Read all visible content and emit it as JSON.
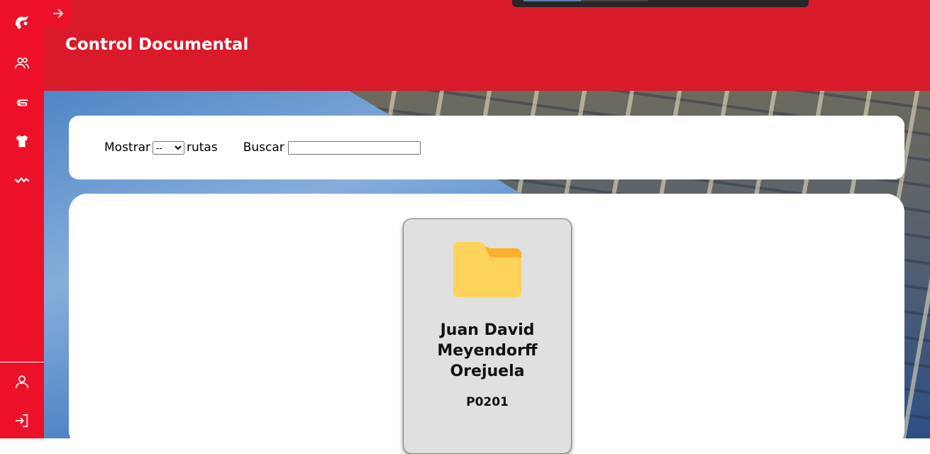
{
  "header": {
    "title": "Control Documental"
  },
  "sidebar": {
    "top_items": [
      {
        "icon": "logo-icon"
      },
      {
        "icon": "users-icon"
      },
      {
        "icon": "paperclip-icon"
      },
      {
        "icon": "shirt-icon"
      },
      {
        "icon": "activity-icon"
      }
    ],
    "bottom_items": [
      {
        "icon": "user-icon"
      },
      {
        "icon": "logout-icon"
      }
    ],
    "toggle_icon": "arrow-right-icon"
  },
  "filters": {
    "show_label": "Mostrar",
    "show_select_value": "--",
    "show_suffix": "rutas",
    "search_label": "Buscar",
    "search_value": ""
  },
  "folders": [
    {
      "name": "Juan David Meyendorff Orejuela",
      "code": "P0201",
      "icon": "folder-icon"
    }
  ],
  "colors": {
    "sidebar": "#ec1129",
    "header": "#d91a2a",
    "folder_yellow": "#fdd35b",
    "folder_tab": "#fbb130"
  }
}
